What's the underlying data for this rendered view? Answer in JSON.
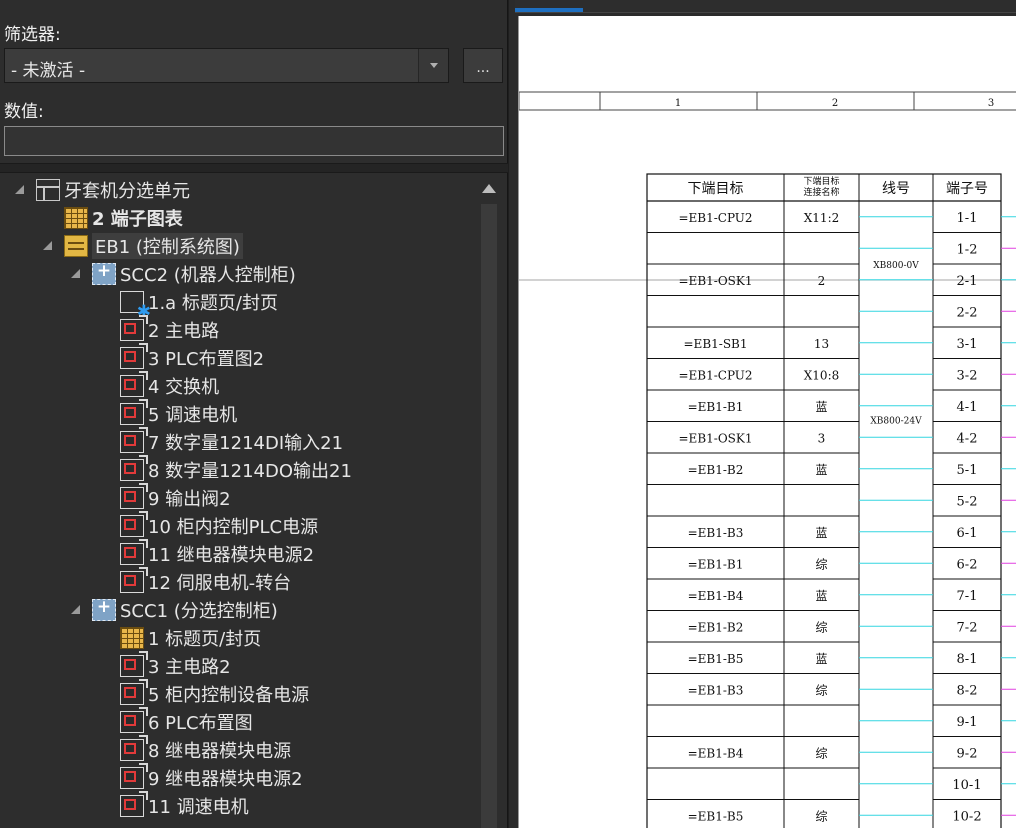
{
  "filter": {
    "label": "筛选器:",
    "selected": "- 未激活 -",
    "more_button": "..."
  },
  "value": {
    "label": "数值:",
    "input_value": ""
  },
  "tree": [
    {
      "label": "牙套机分选单元",
      "icon": "unit-icon",
      "level": 0,
      "expander": true
    },
    {
      "label": "2 端子图表",
      "icon": "table-icon",
      "level": 1,
      "bold": true
    },
    {
      "label": "EB1 (控制系统图)",
      "icon": "system-icon",
      "level": 1,
      "expander": true,
      "highlight": true
    },
    {
      "label": "SCC2 (机器人控制柜)",
      "icon": "cabinet-icon",
      "level": 2,
      "expander": true
    },
    {
      "label": "1.a 标题页/封页",
      "icon": "cover-page-icon",
      "level": 3
    },
    {
      "label": "2 主电路",
      "icon": "page-icon",
      "level": 3
    },
    {
      "label": "3 PLC布置图2",
      "icon": "page-icon",
      "level": 3
    },
    {
      "label": "4 交换机",
      "icon": "page-icon",
      "level": 3
    },
    {
      "label": "5 调速电机",
      "icon": "page-icon",
      "level": 3
    },
    {
      "label": "7 数字量1214DI输入21",
      "icon": "page-icon",
      "level": 3
    },
    {
      "label": "8 数字量1214DO输出21",
      "icon": "page-icon",
      "level": 3
    },
    {
      "label": "9 输出阀2",
      "icon": "page-icon",
      "level": 3
    },
    {
      "label": "10 柜内控制PLC电源",
      "icon": "page-icon",
      "level": 3
    },
    {
      "label": "11 继电器模块电源2",
      "icon": "page-icon",
      "level": 3
    },
    {
      "label": "12 伺服电机-转台",
      "icon": "page-icon",
      "level": 3
    },
    {
      "label": "SCC1 (分选控制柜)",
      "icon": "cabinet-icon",
      "level": 2,
      "expander": true
    },
    {
      "label": "1 标题页/封页",
      "icon": "table-icon",
      "level": 3
    },
    {
      "label": "3 主电路2",
      "icon": "page-icon",
      "level": 3
    },
    {
      "label": "5 柜内控制设备电源",
      "icon": "page-icon",
      "level": 3
    },
    {
      "label": "6 PLC布置图",
      "icon": "page-icon",
      "level": 3
    },
    {
      "label": "8 继电器模块电源",
      "icon": "page-icon",
      "level": 3
    },
    {
      "label": "9 继电器模块电源2",
      "icon": "page-icon",
      "level": 3
    },
    {
      "label": "11 调速电机",
      "icon": "page-icon",
      "level": 3
    }
  ],
  "drawing": {
    "ruler_columns": [
      "1",
      "2",
      "3"
    ],
    "headers": {
      "target": "下端目标",
      "conn_name": [
        "下端目标",
        "连接名称"
      ],
      "wire": "线号",
      "terminal": "端子号"
    },
    "rows": [
      {
        "target": "=EB1-CPU2",
        "conn": "X11:2",
        "terminal": "1-1"
      },
      {
        "target": "",
        "conn": "",
        "terminal": "1-2"
      },
      {
        "target": "=EB1-OSK1",
        "conn": "2",
        "terminal": "2-1"
      },
      {
        "target": "",
        "conn": "",
        "terminal": "2-2"
      },
      {
        "target": "=EB1-SB1",
        "conn": "13",
        "terminal": "3-1"
      },
      {
        "target": "=EB1-CPU2",
        "conn": "X10:8",
        "terminal": "3-2"
      },
      {
        "target": "=EB1-B1",
        "conn": "蓝",
        "terminal": "4-1"
      },
      {
        "target": "=EB1-OSK1",
        "conn": "3",
        "terminal": "4-2"
      },
      {
        "target": "=EB1-B2",
        "conn": "蓝",
        "terminal": "5-1"
      },
      {
        "target": "",
        "conn": "",
        "terminal": "5-2"
      },
      {
        "target": "=EB1-B3",
        "conn": "蓝",
        "terminal": "6-1"
      },
      {
        "target": "=EB1-B1",
        "conn": "综",
        "terminal": "6-2"
      },
      {
        "target": "=EB1-B4",
        "conn": "蓝",
        "terminal": "7-1"
      },
      {
        "target": "=EB1-B2",
        "conn": "综",
        "terminal": "7-2"
      },
      {
        "target": "=EB1-B5",
        "conn": "蓝",
        "terminal": "8-1"
      },
      {
        "target": "=EB1-B3",
        "conn": "综",
        "terminal": "8-2"
      },
      {
        "target": "",
        "conn": "",
        "terminal": "9-1"
      },
      {
        "target": "=EB1-B4",
        "conn": "综",
        "terminal": "9-2"
      },
      {
        "target": "",
        "conn": "",
        "terminal": "10-1"
      },
      {
        "target": "=EB1-B5",
        "conn": "综",
        "terminal": "10-2"
      }
    ],
    "wire_labels": [
      "XB800-0V",
      "XB800-24V"
    ],
    "colors": {
      "wire_cyan": "#33d6e0",
      "wire_magenta": "#e040e0",
      "accent": "#1e6fc0"
    }
  }
}
